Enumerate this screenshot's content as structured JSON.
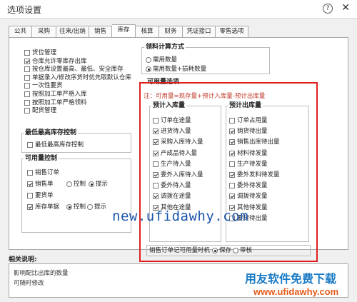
{
  "window": {
    "title": "选项设置",
    "help": "?",
    "close": "✕"
  },
  "tabs": [
    "公共",
    "采购",
    "往来/出纳",
    "销售",
    "库存",
    "核算",
    "财务",
    "凭证接口",
    "零售选项"
  ],
  "left_options": [
    {
      "label": "货位管理",
      "checked": false
    },
    {
      "label": "仓库允许零库存出库",
      "checked": true
    },
    {
      "label": "按仓库设置最高、最低、安全库存",
      "checked": false
    },
    {
      "label": "单据录入/修改序货时优先取默认仓库",
      "checked": false
    },
    {
      "label": "一次性要货",
      "checked": false
    },
    {
      "label": "按照加工单严格入库",
      "checked": false
    },
    {
      "label": "按照加工单严格领料",
      "checked": false
    },
    {
      "label": "配货管理",
      "checked": false
    }
  ],
  "stock_ctrl": {
    "title": "最低最高库存控制",
    "option": "最低最高库存控制",
    "checked": false
  },
  "avail_ctrl": {
    "title": "可用量控制",
    "sales_order": {
      "label": "销售订单",
      "checked": false
    },
    "sales_single": {
      "label": "销售单",
      "checked": true,
      "opt1": "控制",
      "opt2": "提示",
      "selected": 2
    },
    "request": {
      "label": "要货单",
      "checked": false
    },
    "transfer": {
      "label": "库存单据",
      "checked": true,
      "opt1": "控制",
      "opt2": "提示",
      "selected": 1
    }
  },
  "calc_method": {
    "title": "领料计算方式",
    "opt1": "需用数量",
    "opt2": "需用数量+损耗数量",
    "selected": 2
  },
  "avail_options": {
    "title": "可用量选项",
    "note": "注：可用量=现存量+预计入库量-预计出库量",
    "incoming": {
      "title": "预计入库量",
      "items": [
        {
          "label": "订单在途量",
          "checked": false
        },
        {
          "label": "进货待入量",
          "checked": true
        },
        {
          "label": "采购入库待入量",
          "checked": true
        },
        {
          "label": "产成品待入量",
          "checked": true
        },
        {
          "label": "生产待入量",
          "checked": false
        },
        {
          "label": "委外入库待入量",
          "checked": true
        },
        {
          "label": "委外待入量",
          "checked": false
        },
        {
          "label": "调拨在途量",
          "checked": true
        },
        {
          "label": "其他在途量",
          "checked": true
        }
      ]
    },
    "outgoing": {
      "title": "预计出库量",
      "items": [
        {
          "label": "订单占用量",
          "checked": false
        },
        {
          "label": "销货待出量",
          "checked": true
        },
        {
          "label": "销售出库待出量",
          "checked": true
        },
        {
          "label": "材料待发量",
          "checked": true
        },
        {
          "label": "生产待发量",
          "checked": false
        },
        {
          "label": "委外发料待发量",
          "checked": true
        },
        {
          "label": "委外待发量",
          "checked": false
        },
        {
          "label": "调拨待发量",
          "checked": true
        },
        {
          "label": "其他待发量",
          "checked": true
        },
        {
          "label": "要货待出量",
          "checked": false
        }
      ]
    },
    "timing": {
      "label": "销售订单记可用量时机",
      "opt1": "保存",
      "opt2": "审核",
      "selected": 1
    }
  },
  "watermark_mid": "new.ufidawhy.com",
  "description": {
    "title": "相关说明:",
    "lines": [
      "影响配比出库的数量",
      "可随时修改"
    ]
  },
  "watermark_logo": "用友软件免费下载",
  "watermark_url": "www.ufidawhy.com"
}
